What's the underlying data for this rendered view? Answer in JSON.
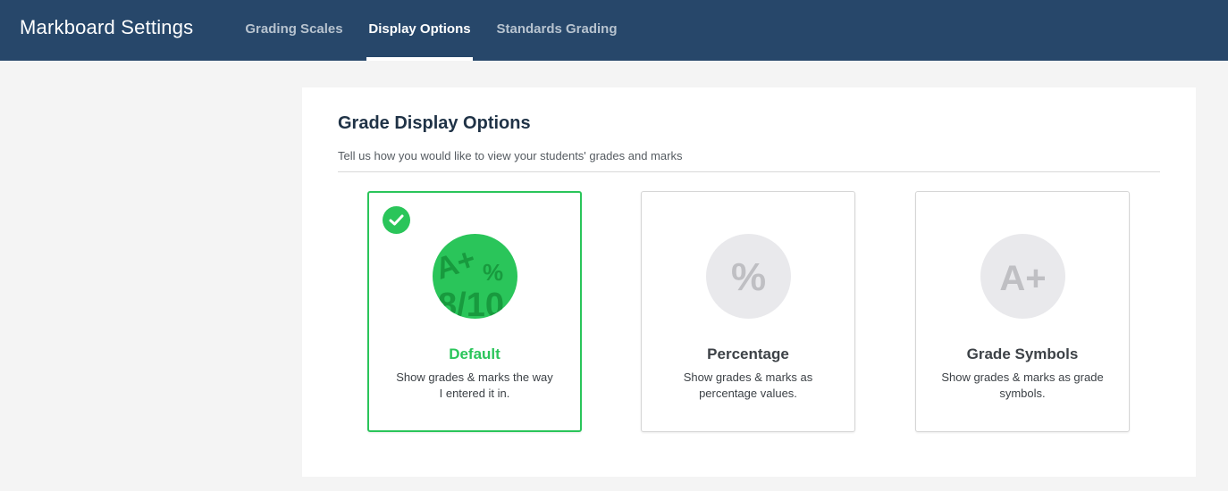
{
  "header": {
    "title": "Markboard Settings",
    "tabs": [
      {
        "label": "Grading Scales",
        "active": false
      },
      {
        "label": "Display Options",
        "active": true
      },
      {
        "label": "Standards Grading",
        "active": false
      }
    ],
    "background_color": "#27476a"
  },
  "panel": {
    "title": "Grade Display Options",
    "subtitle": "Tell us how you would like to view your students' grades and marks"
  },
  "options": [
    {
      "key": "default",
      "icon": "mixed-grades-icon",
      "icon_text": [
        "A+",
        "%",
        "8/10"
      ],
      "title": "Default",
      "description": "Show grades & marks the way I entered it in.",
      "selected": true
    },
    {
      "key": "percentage",
      "icon": "percent-icon",
      "icon_text": "%",
      "title": "Percentage",
      "description": "Show grades & marks as percentage values.",
      "selected": false
    },
    {
      "key": "symbols",
      "icon": "grade-symbol-icon",
      "icon_text": "A+",
      "title": "Grade Symbols",
      "description": "Show grades & marks as grade symbols.",
      "selected": false
    }
  ],
  "colors": {
    "accent": "#2ac55a",
    "text": "#3d4247",
    "icon_grey": "#e9e9ec"
  }
}
